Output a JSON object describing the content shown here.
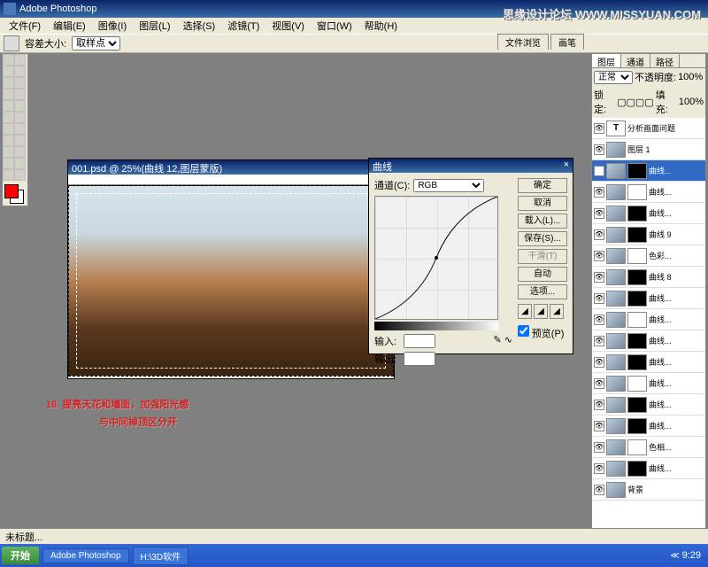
{
  "app": {
    "title": "Adobe Photoshop"
  },
  "menu": [
    "文件(F)",
    "编辑(E)",
    "图像(I)",
    "图层(L)",
    "选择(S)",
    "滤镜(T)",
    "视图(V)",
    "窗口(W)",
    "帮助(H)"
  ],
  "options": {
    "label1": "容差大小:",
    "dropdown": "取样点"
  },
  "watermark": "思缘设计论坛  WWW.MISSYUAN.COM",
  "topTabs": [
    "文件浏览",
    "画笔"
  ],
  "doc": {
    "title": "001.psd @ 25%(曲线 12,图层蒙版)",
    "winbtns": "_ □ ×"
  },
  "curves": {
    "title": "曲线",
    "winbtns": "×",
    "channelLabel": "通道(C):",
    "channel": "RGB",
    "buttons": [
      "确定",
      "取消",
      "载入(L)...",
      "保存(S)...",
      "干滑(T)",
      "自动",
      "选项..."
    ],
    "input": "输入:",
    "output": "输出:",
    "preview": "预览(P)"
  },
  "layers": {
    "tabs": [
      "图层",
      "通道",
      "路径"
    ],
    "blend": "正常",
    "opacityLabel": "不透明度:",
    "opacity": "100%",
    "lockLabel": "锁定:",
    "fillLabel": "填充:",
    "fill": "100%",
    "items": [
      {
        "name": "分析画面问题",
        "type": "T"
      },
      {
        "name": "图层 1",
        "type": "img"
      },
      {
        "name": "曲线...",
        "type": "adj",
        "sel": true
      },
      {
        "name": "曲线...",
        "type": "adj"
      },
      {
        "name": "曲线...",
        "type": "adj"
      },
      {
        "name": "曲线 9",
        "type": "adj"
      },
      {
        "name": "色彩...",
        "type": "adj"
      },
      {
        "name": "曲线 8",
        "type": "adj"
      },
      {
        "name": "曲线...",
        "type": "adj"
      },
      {
        "name": "曲线...",
        "type": "adj"
      },
      {
        "name": "曲线...",
        "type": "adj"
      },
      {
        "name": "曲线...",
        "type": "adj"
      },
      {
        "name": "曲线...",
        "type": "adj"
      },
      {
        "name": "曲线...",
        "type": "adj"
      },
      {
        "name": "曲线...",
        "type": "adj"
      },
      {
        "name": "色相...",
        "type": "adj"
      },
      {
        "name": "曲线...",
        "type": "adj"
      },
      {
        "name": "背景",
        "type": "bg"
      }
    ]
  },
  "annotation": {
    "line1": "16. 提亮天花和墙面，加强阳光感",
    "line2": "与中间掉顶区分开"
  },
  "statusbar": "未标题...",
  "taskbar": {
    "start": "开始",
    "tasks": [
      "Adobe Photoshop",
      "H:\\3D软件"
    ],
    "time": "9:29"
  }
}
